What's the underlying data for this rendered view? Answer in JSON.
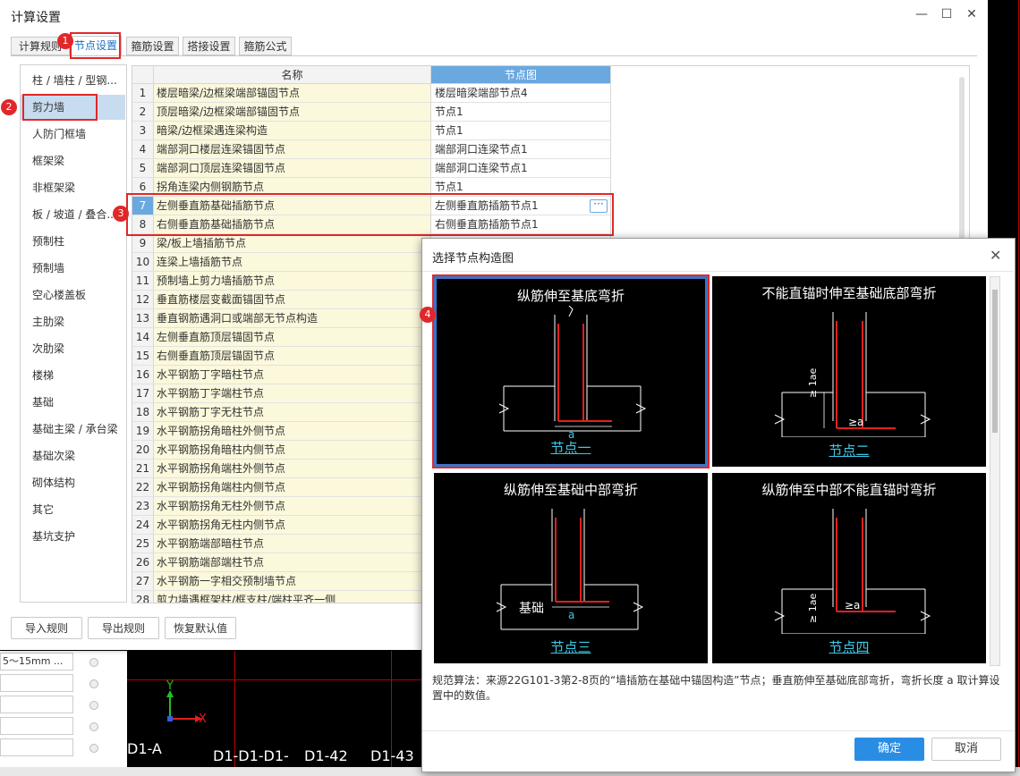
{
  "dialog": {
    "title": "计算设置",
    "window_controls": [
      "—",
      "☐",
      "✕"
    ],
    "tabs": [
      {
        "label": "计算规则"
      },
      {
        "label": "节点设置"
      },
      {
        "label": "箍筋设置"
      },
      {
        "label": "搭接设置"
      },
      {
        "label": "箍筋公式"
      }
    ],
    "active_tab": "节点设置",
    "categories": [
      "柱 / 墙柱 / 型钢...",
      "剪力墙",
      "人防门框墙",
      "框架梁",
      "非框架梁",
      "板 / 坡道 / 叠合...",
      "预制柱",
      "预制墙",
      "空心楼盖板",
      "主肋梁",
      "次肋梁",
      "楼梯",
      "基础",
      "基础主梁 / 承台梁",
      "基础次梁",
      "砌体结构",
      "其它",
      "基坑支护"
    ],
    "selected_category": "剪力墙",
    "grid_headers": {
      "name": "名称",
      "node": "节点图"
    },
    "rows": [
      {
        "n": "1",
        "name": "楼层暗梁/边框梁端部锚固节点",
        "node": "楼层暗梁端部节点4"
      },
      {
        "n": "2",
        "name": "顶层暗梁/边框梁端部锚固节点",
        "node": "节点1"
      },
      {
        "n": "3",
        "name": "暗梁/边框梁遇连梁构造",
        "node": "节点1"
      },
      {
        "n": "4",
        "name": "端部洞口楼层连梁锚固节点",
        "node": "端部洞口连梁节点1"
      },
      {
        "n": "5",
        "name": "端部洞口顶层连梁锚固节点",
        "node": "端部洞口连梁节点1"
      },
      {
        "n": "6",
        "name": "拐角连梁内侧钢筋节点",
        "node": "节点1"
      },
      {
        "n": "7",
        "name": "左侧垂直筋基础插筋节点",
        "node": "左侧垂直筋插筋节点1"
      },
      {
        "n": "8",
        "name": "右侧垂直筋基础插筋节点",
        "node": "右侧垂直筋插筋节点1"
      },
      {
        "n": "9",
        "name": "梁/板上墙插筋节点",
        "node": ""
      },
      {
        "n": "10",
        "name": "连梁上墙插筋节点",
        "node": ""
      },
      {
        "n": "11",
        "name": "预制墙上剪力墙插筋节点",
        "node": ""
      },
      {
        "n": "12",
        "name": "垂直筋楼层变截面锚固节点",
        "node": ""
      },
      {
        "n": "13",
        "name": "垂直钢筋遇洞口或端部无节点构造",
        "node": ""
      },
      {
        "n": "14",
        "name": "左侧垂直筋顶层锚固节点",
        "node": ""
      },
      {
        "n": "15",
        "name": "右侧垂直筋顶层锚固节点",
        "node": ""
      },
      {
        "n": "16",
        "name": "水平钢筋丁字暗柱节点",
        "node": ""
      },
      {
        "n": "17",
        "name": "水平钢筋丁字端柱节点",
        "node": ""
      },
      {
        "n": "18",
        "name": "水平钢筋丁字无柱节点",
        "node": ""
      },
      {
        "n": "19",
        "name": "水平钢筋拐角暗柱外侧节点",
        "node": ""
      },
      {
        "n": "20",
        "name": "水平钢筋拐角暗柱内侧节点",
        "node": ""
      },
      {
        "n": "21",
        "name": "水平钢筋拐角端柱外侧节点",
        "node": ""
      },
      {
        "n": "22",
        "name": "水平钢筋拐角端柱内侧节点",
        "node": ""
      },
      {
        "n": "23",
        "name": "水平钢筋拐角无柱外侧节点",
        "node": ""
      },
      {
        "n": "24",
        "name": "水平钢筋拐角无柱内侧节点",
        "node": ""
      },
      {
        "n": "25",
        "name": "水平钢筋端部暗柱节点",
        "node": ""
      },
      {
        "n": "26",
        "name": "水平钢筋端部端柱节点",
        "node": ""
      },
      {
        "n": "27",
        "name": "水平钢筋一字相交预制墙节点",
        "node": ""
      },
      {
        "n": "28",
        "name": "剪力墙遇框架柱/框支柱/端柱平齐一侧",
        "node": ""
      }
    ],
    "selected_row": "7",
    "ellipsis": "···",
    "buttons": {
      "import": "导入规则",
      "export": "导出规则",
      "reset": "恢复默认值"
    },
    "badges": [
      "1",
      "2",
      "3",
      "4"
    ]
  },
  "popup": {
    "title": "选择节点构造图",
    "close": "✕",
    "cards": [
      {
        "title": "纵筋伸至基底弯折",
        "caption": "节点一",
        "dim_a": "a",
        "selected": true
      },
      {
        "title": "不能直锚时伸至基础底部弯折",
        "caption": "节点二",
        "dim_a": "≥a",
        "dim_lae": "≥ 1ae"
      },
      {
        "title": "纵筋伸至基础中部弯折",
        "caption": "节点三",
        "dim_a": "a",
        "label_base": "基础"
      },
      {
        "title": "纵筋伸至中部不能直锚时弯折",
        "caption": "节点四",
        "dim_a": "≥a",
        "dim_lae": "≥ 1ae"
      }
    ],
    "description": "规范算法：来源22G101-3第2-8页的“墙插筋在基础中锚固构造”节点；垂直筋伸至基础底部弯折，弯折长度 a 取计算设置中的数值。",
    "ok": "确定",
    "cancel": "取消"
  },
  "background": {
    "field_values": [
      "5～15mm ...",
      "",
      "",
      "",
      ""
    ],
    "axis_x": "X",
    "axis_y": "Y",
    "labels": [
      "D1-A",
      "D1-D1-D1-",
      "D1-42",
      "D1-43"
    ]
  },
  "colors": {
    "accent": "#2a8de4",
    "highlight": "#e0282a",
    "header_blue": "#6aa8e0",
    "name_bg": "#fbf8dc",
    "node_caption": "#3cc8e8",
    "rebar": "#e02020"
  }
}
